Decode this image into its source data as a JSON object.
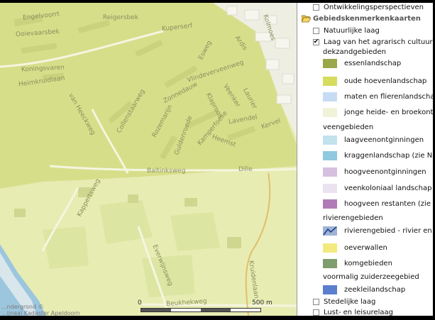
{
  "layers": {
    "top_item": {
      "label": "Ontwikkelingsperspectieven",
      "checked": false
    },
    "group": {
      "label": "Gebiedskenmerkenkaarten",
      "icon": "folder-open-icon"
    },
    "items": [
      {
        "label": "Natuurlijke laag",
        "checked": false
      },
      {
        "label": "Laag van het agrarisch cultuurl",
        "checked": true
      }
    ]
  },
  "legend": {
    "sections": [
      {
        "heading": "dekzandgebieden",
        "entries": [
          {
            "label": "essenlandschap",
            "color": "#9aa84a"
          },
          {
            "label": "oude hoevenlandschap",
            "color": "#d6dc5c"
          },
          {
            "label": "maten en flierenlandschap",
            "color": "#c6dcf2"
          },
          {
            "label": "jonge heide- en broekont",
            "color": "#f1f3d8"
          }
        ]
      },
      {
        "heading": "veengebieden",
        "entries": [
          {
            "label": "laagveenontginningen",
            "color": "#c2e2ec"
          },
          {
            "label": "kraggenlandschap (zie Na",
            "color": "#8ec9df"
          },
          {
            "label": "hoogveenontginningen",
            "color": "#d7c0de"
          },
          {
            "label": "veenkoloniaal landschap",
            "color": "#ebe2ef"
          },
          {
            "label": "hoogveen restanten (zie",
            "color": "#b17bb7"
          }
        ]
      },
      {
        "heading": "rivierengebieden",
        "entries": [
          {
            "label": "rivierengebied - rivier en",
            "color": "#9fb4d4",
            "icon": "river-line-icon"
          },
          {
            "label": "oeverwallen",
            "color": "#f2ea7e"
          },
          {
            "label": "komgebieden",
            "color": "#7f9d6d"
          }
        ]
      },
      {
        "heading": "voormalig zuiderzeegebied",
        "entries": [
          {
            "label": "zeekleilandschap",
            "color": "#5a7fce"
          }
        ]
      }
    ],
    "bottom_items": [
      {
        "label": "Stedelijke laag",
        "checked": false
      },
      {
        "label": "Lust- en leisurelaag",
        "checked": false
      }
    ]
  },
  "map": {
    "street_labels": [
      "Engelvoorrt",
      "Ooievaarsbek",
      "Reigersbek",
      "Kuperserf",
      "Koningsvaren",
      "Heimkruidlaan",
      "van Heeckweg",
      "Zonnedauw",
      "Vlindeverveenweg",
      "Esweg",
      "Ardis",
      "Kolmoes",
      "Collenstaarweg",
      "Rozemarijn",
      "Klaproos",
      "Veenker",
      "Laurier",
      "Guldenroede",
      "Kamperfoelie",
      "Lavendel",
      "Kervel",
      "Heemst",
      "Baltinksweg",
      "Dille",
      "Kappertsweg",
      "Everwijnsweg",
      "Kruidenlaan",
      "Beukhekweg"
    ],
    "scale_start": "0",
    "scale_end": "500 m",
    "copyright": [
      "...ndergrond ©",
      "...ijnaal Kadaster Apeldoorn"
    ]
  }
}
